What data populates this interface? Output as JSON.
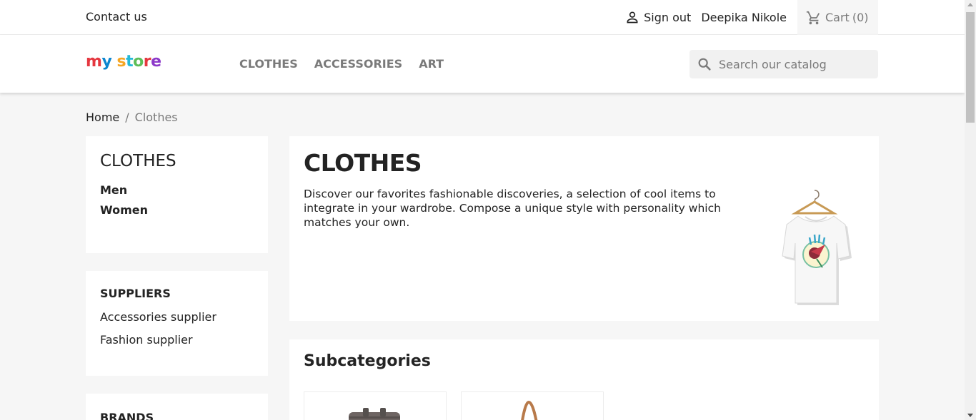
{
  "topbar": {
    "contact_label": "Contact us",
    "signout_label": "Sign out",
    "user_name": "Deepika Nikole",
    "cart_label": "Cart",
    "cart_count": "(0)"
  },
  "header": {
    "logo_text": "my store",
    "logo_colors": [
      "#e5373f",
      "#0c86cf",
      "#f5a623",
      "#24b9d7",
      "#5dbd58",
      "#e5373f",
      "#8c39c9"
    ],
    "nav": [
      "CLOTHES",
      "ACCESSORIES",
      "ART"
    ],
    "search_placeholder": "Search our catalog"
  },
  "breadcrumb": {
    "home": "Home",
    "separator": "/",
    "current": "Clothes"
  },
  "sidebar": {
    "category": {
      "title": "CLOTHES",
      "items": [
        "Men",
        "Women"
      ]
    },
    "suppliers": {
      "title": "SUPPLIERS",
      "items": [
        "Accessories supplier",
        "Fashion supplier"
      ]
    },
    "brands": {
      "title": "BRANDS"
    }
  },
  "main": {
    "category_title": "CLOTHES",
    "description": "Discover our favorites fashionable discoveries, a selection of cool items to integrate in your wardrobe. Compose a unique style with personality which matches your own.",
    "subcategories_title": "Subcategories"
  },
  "colors": {
    "accent_gray": "#7a7a7a",
    "text_dark": "#232323",
    "background": "#f6f6f6"
  }
}
